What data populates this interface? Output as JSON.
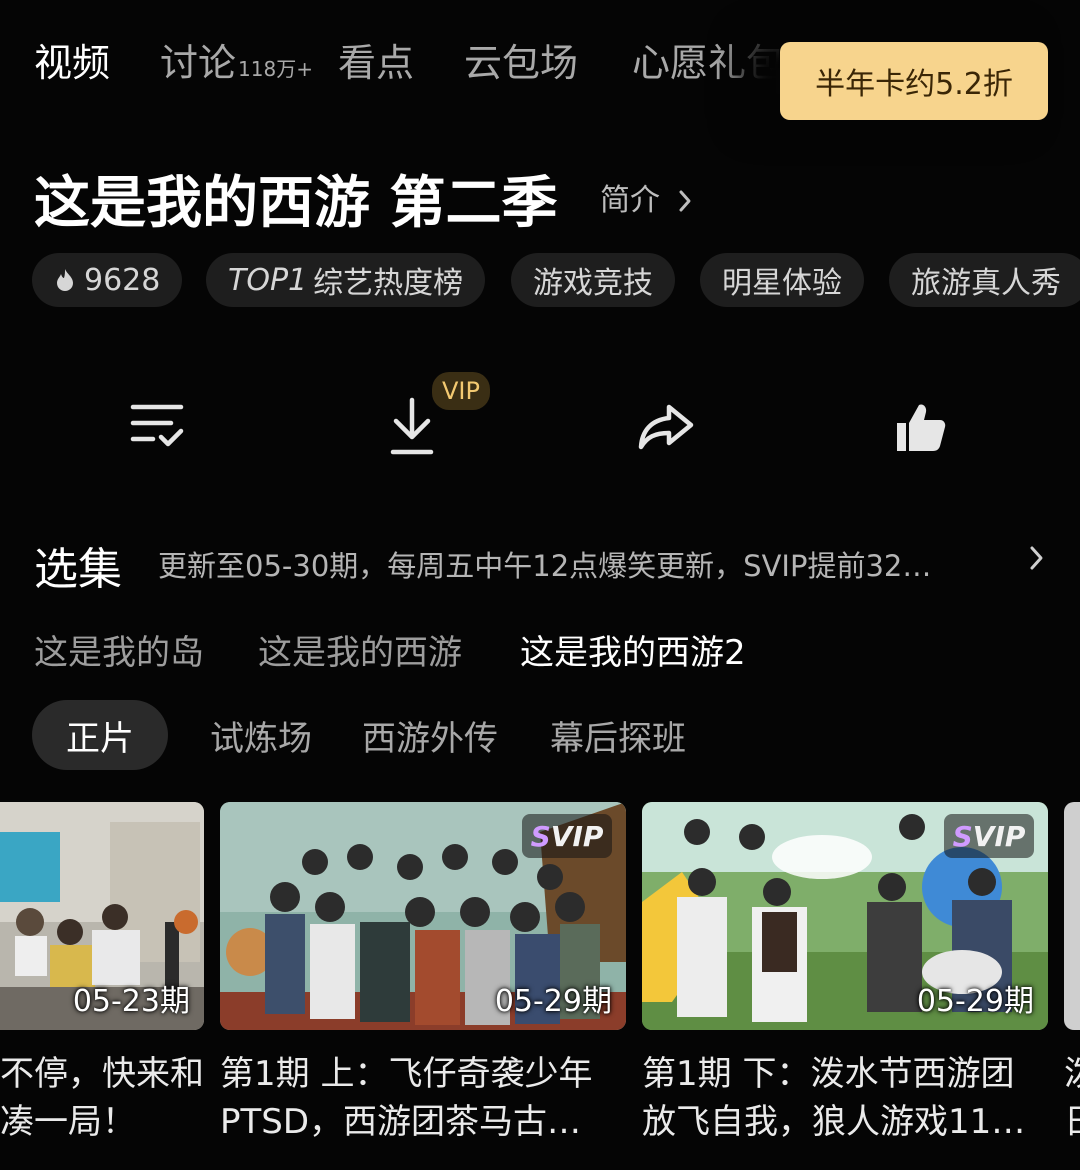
{
  "tabs": [
    {
      "label": "视频",
      "active": true
    },
    {
      "label": "讨论",
      "count": "118万+"
    },
    {
      "label": "看点"
    },
    {
      "label": "云包场"
    },
    {
      "label": "心愿礼包"
    }
  ],
  "promo": {
    "label": "半年卡约5.2折"
  },
  "show": {
    "title": "这是我的西游 第二季",
    "intro_label": "简介"
  },
  "tags": {
    "heat": "9628",
    "rank_top": "TOP1",
    "rank_label": "综艺热度榜",
    "genre1": "游戏竞技",
    "genre2": "明星体验",
    "genre3": "旅游真人秀"
  },
  "actions": {
    "vip_badge": "VIP",
    "icons": [
      "playlist-check-icon",
      "download-icon",
      "share-icon",
      "thumbs-up-icon"
    ]
  },
  "episodes": {
    "section_title": "选集",
    "update_info": "更新至05-30期，每周五中午12点爆笑更新，SVIP提前32…",
    "seasons": [
      "这是我的岛",
      "这是我的西游",
      "这是我的西游2"
    ],
    "categories": [
      "正片",
      "试炼场",
      "西游外传",
      "幕后探班"
    ],
    "cards": [
      {
        "date": "05-23期",
        "badge": "",
        "line1": "不停，快来和",
        "line2": "凑一局！"
      },
      {
        "date": "05-29期",
        "badge": "SVIP",
        "line1": "第1期 上：飞仔奇袭少年",
        "line2": "PTSD，西游团茶马古…"
      },
      {
        "date": "05-29期",
        "badge": "SVIP",
        "line1": "第1期 下：泼水节西游团",
        "line2": "放飞自我，狼人游戏11…"
      }
    ],
    "next_card_line1": "泼",
    "next_card_line2": "日"
  },
  "colors": {
    "background": "#050505",
    "promo_bg": "#f7d48d",
    "vip_gold": "#f3c971",
    "svip_purple": "#d09bff"
  }
}
